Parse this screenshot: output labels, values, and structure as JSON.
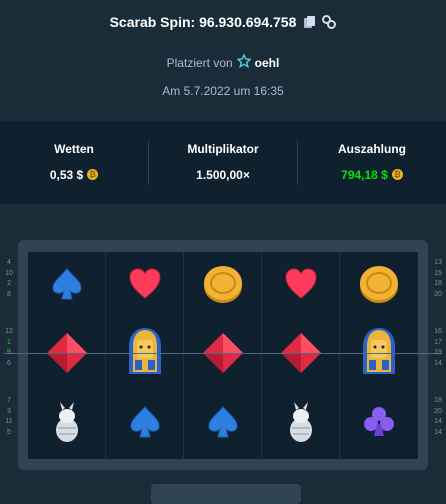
{
  "header": {
    "title": "Scarab Spin: 96.930.694.758",
    "icons": [
      "copy-icon",
      "link-icon"
    ],
    "placed_by_label": "Platziert von",
    "username": "oehl",
    "date": "Am 5.7.2022 um 16:35"
  },
  "stats": {
    "bet_label": "Wetten",
    "bet_value": "0,53 $",
    "multiplier_label": "Multiplikator",
    "multiplier_value": "1.500,00×",
    "payout_label": "Auszahlung",
    "payout_value": "794,18 $"
  },
  "colors": {
    "background": "#1a2c38",
    "panel": "#0f212e",
    "payout_green": "#00e701",
    "accent_blue": "#1475e1"
  },
  "reels": [
    [
      "spade",
      "diamond",
      "scarab"
    ],
    [
      "heart",
      "pharaoh",
      "spade"
    ],
    [
      "coin",
      "diamond",
      "spade"
    ],
    [
      "heart",
      "diamond",
      "scarab"
    ],
    [
      "coin",
      "pharaoh",
      "club"
    ]
  ],
  "paylines": {
    "left": [
      [
        "4",
        "10",
        "2",
        "8"
      ],
      [
        "12",
        "1",
        "9",
        "6"
      ],
      [
        "7",
        "3",
        "11",
        "5"
      ]
    ],
    "right": [
      [
        "13",
        "15",
        "18",
        "20"
      ],
      [
        "16",
        "17",
        "19",
        "14"
      ],
      [
        "18",
        "20",
        "14",
        "14"
      ]
    ],
    "active": "1"
  }
}
